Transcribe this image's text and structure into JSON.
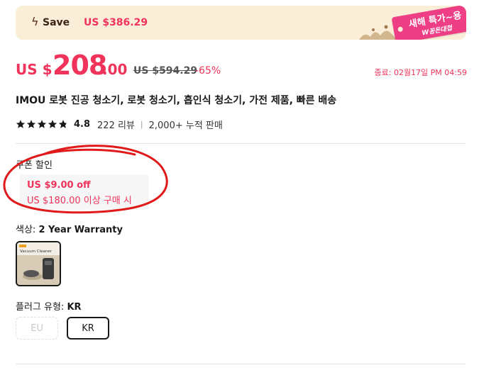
{
  "banner": {
    "save_label": "Save",
    "save_amount": "US $386.29",
    "promo_line1": "새해 특가~용",
    "promo_line2": "W꽁돈대첩"
  },
  "price": {
    "currency": "US $",
    "integer": "208",
    "decimal": ".00",
    "original": "US $594.29",
    "discount": "-65%",
    "ends": "종료: 02월17일 PM 04:59"
  },
  "product": {
    "title": "IMOU 로봇 진공 청소기, 로봇 청소기, 흡인식 청소기, 가전 제품, 빠른 배송",
    "rating": 4.8,
    "rating_text": "4.8",
    "reviews": "222 리뷰",
    "separator": "|",
    "sold": "2,000+ 누적 판매"
  },
  "coupon": {
    "label": "쿠폰 할인",
    "amount": "US $9.00 off",
    "condition": "US $180.00 이상 구매 시"
  },
  "color": {
    "label": "색상: ",
    "value": "2 Year Warranty",
    "thumb_title": "Vacuum Cleaner"
  },
  "plug": {
    "label": "플러그 유형: ",
    "value": "KR",
    "options": [
      "EU",
      "KR"
    ]
  },
  "colors": {
    "accent": "#f0335a",
    "banner_bg": "#fbeed8",
    "promo_pink": "#ee3f86"
  }
}
